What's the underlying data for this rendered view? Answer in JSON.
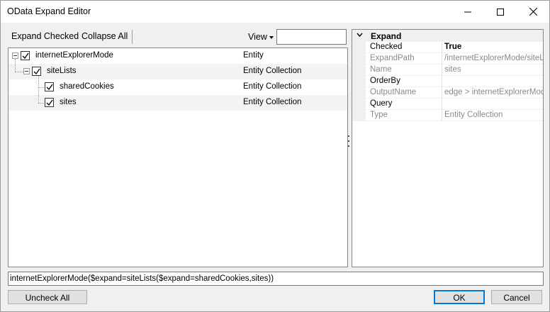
{
  "window": {
    "title": "OData Expand Editor"
  },
  "toolbar": {
    "expand_checked_label": "Expand Checked",
    "collapse_all_label": "Collapse All",
    "view_label": "View",
    "view_input_value": ""
  },
  "tree": {
    "rows": [
      {
        "label": "internetExplorerMode",
        "type": "Entity",
        "checked": true,
        "level": 0
      },
      {
        "label": "siteLists",
        "type": "Entity Collection",
        "checked": true,
        "level": 1
      },
      {
        "label": "sharedCookies",
        "type": "Entity Collection",
        "checked": true,
        "level": 2
      },
      {
        "label": "sites",
        "type": "Entity Collection",
        "checked": true,
        "level": 2
      }
    ]
  },
  "properties": {
    "category": "Expand",
    "rows": [
      {
        "name": "Checked",
        "value": "True",
        "readonly": false,
        "bold": true
      },
      {
        "name": "ExpandPath",
        "value": "/internetExplorerMode/siteLists",
        "readonly": true,
        "bold": false
      },
      {
        "name": "Name",
        "value": "sites",
        "readonly": true,
        "bold": false
      },
      {
        "name": "OrderBy",
        "value": "",
        "readonly": false,
        "bold": false
      },
      {
        "name": "OutputName",
        "value": "edge > internetExplorerMode",
        "readonly": true,
        "bold": false
      },
      {
        "name": "Query",
        "value": "",
        "readonly": false,
        "bold": false
      },
      {
        "name": "Type",
        "value": "Entity Collection",
        "readonly": true,
        "bold": false
      }
    ]
  },
  "expression": "internetExplorerMode($expand=siteLists($expand=sharedCookies,sites))",
  "buttons": {
    "uncheck_all_label": "Uncheck All",
    "ok_label": "OK",
    "cancel_label": "Cancel"
  },
  "icons": {
    "minimize": "minimize-icon",
    "maximize": "maximize-icon",
    "close": "close-icon",
    "checkbox": "checkmark-icon",
    "collapse": "collapse-icon",
    "caret": "caret-down-icon"
  },
  "colors": {
    "default_button_border": "#0078d7",
    "readonly_text": "#8a8a8a"
  }
}
